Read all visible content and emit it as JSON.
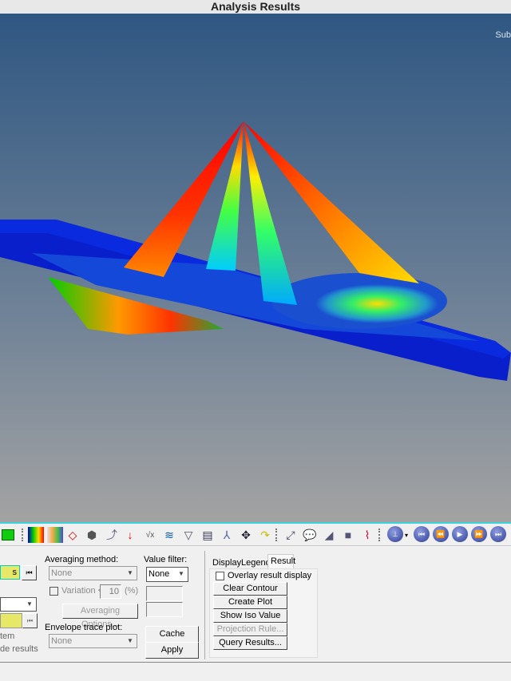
{
  "window": {
    "title": "Analysis Results"
  },
  "viewport": {
    "corner_label": "Sub",
    "colors": {
      "bg_top": "#2f5782",
      "bg_bottom": "#a3a3a3",
      "model": "#0a1fcc"
    }
  },
  "toolbar": {
    "icons": [
      "component-icon",
      "contour-icon",
      "legend-icon",
      "deformed-icon",
      "iso-icon",
      "vector-icon",
      "tensor-icon",
      "measure-icon",
      "derived-results-icon",
      "stream-icon",
      "cut-plane-icon",
      "query-icon",
      "tracking-icon",
      "frame-icon",
      "bead-icon",
      "annotation-icon",
      "note-icon",
      "surface-icon",
      "camera-icon",
      "curve-icon",
      "animation-type-icon",
      "first-frame-icon",
      "rewind-icon",
      "play-icon",
      "fast-forward-icon",
      "last-frame-icon"
    ]
  },
  "left": {
    "field1": "s",
    "field3_label_a": "tem",
    "field3_label_b": "de results"
  },
  "averaging": {
    "label": "Averaging method:",
    "value": "None",
    "variation_label": "Variation <",
    "variation_value": "10",
    "unit": "(%)",
    "options_button": "Averaging Options..."
  },
  "envelope": {
    "label": "Envelope trace plot:",
    "value": "None"
  },
  "value_filter": {
    "label": "Value filter:",
    "value": "None"
  },
  "buttons": {
    "cache": "Cache",
    "apply": "Apply"
  },
  "tabs": [
    {
      "label": "Display"
    },
    {
      "label": "Legend"
    },
    {
      "label": "Result",
      "active": true
    }
  ],
  "result_tab": {
    "overlay_label": "Overlay result display",
    "buttons": [
      "Clear Contour",
      "Create Plot Style...",
      "Show Iso Value",
      "Projection Rule...",
      "Query Results..."
    ]
  }
}
